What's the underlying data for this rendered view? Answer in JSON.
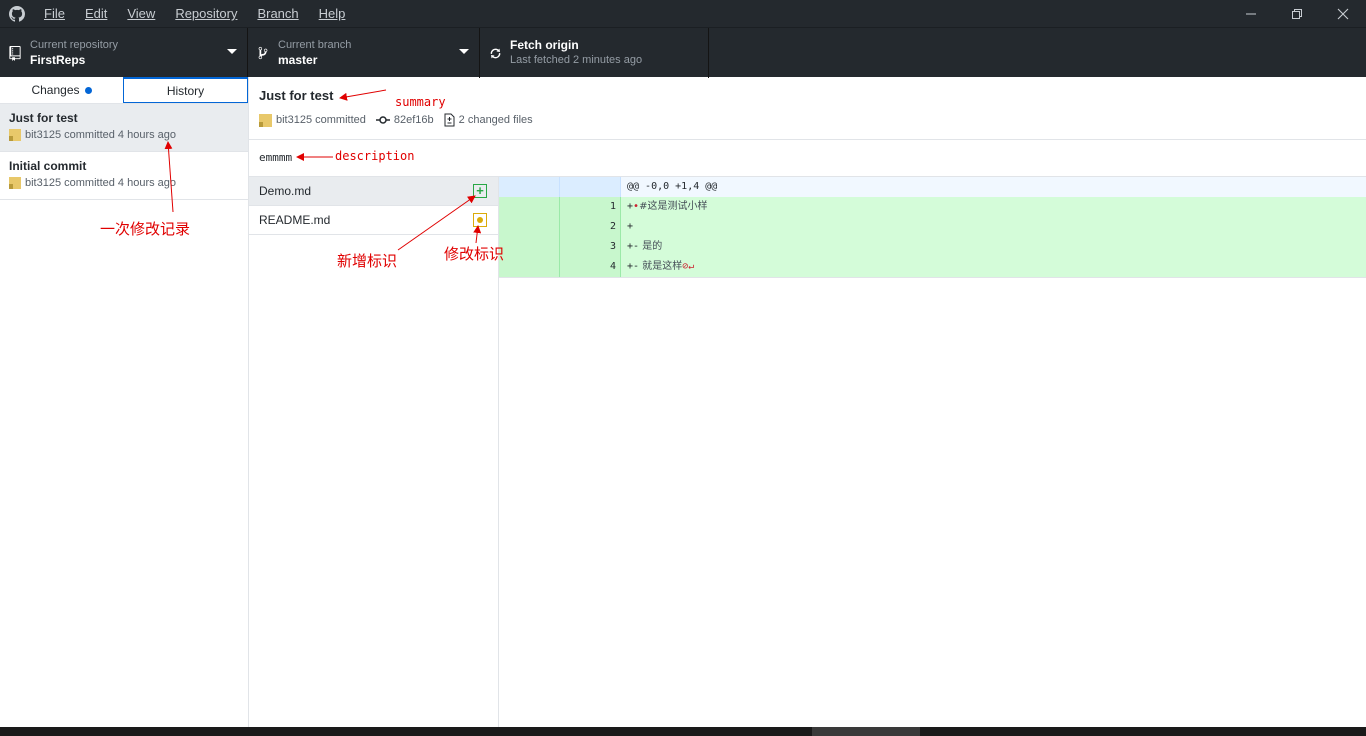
{
  "menu": [
    "File",
    "Edit",
    "View",
    "Repository",
    "Branch",
    "Help"
  ],
  "toolbar": {
    "repo_label": "Current repository",
    "repo_value": "FirstReps",
    "branch_label": "Current branch",
    "branch_value": "master",
    "fetch_title": "Fetch origin",
    "fetch_sub": "Last fetched 2 minutes ago"
  },
  "tabs": {
    "changes": "Changes",
    "history": "History"
  },
  "commits": [
    {
      "title": "Just for test",
      "meta": "bit3125 committed 4 hours ago"
    },
    {
      "title": "Initial commit",
      "meta": "bit3125 committed 4 hours ago"
    }
  ],
  "summary": {
    "title": "Just for test",
    "author": "bit3125 committed",
    "sha": "82ef16b",
    "changed": "2 changed files"
  },
  "description": "emmmm",
  "files": [
    {
      "name": "Demo.md",
      "status": "added"
    },
    {
      "name": "README.md",
      "status": "modified"
    }
  ],
  "diff": {
    "hunk": "@@ -0,0 +1,4 @@",
    "lines": [
      {
        "num": "1",
        "prefix": "+",
        "marker": "•",
        "text": "#这是测试小样"
      },
      {
        "num": "2",
        "prefix": "+",
        "marker": "",
        "text": ""
      },
      {
        "num": "3",
        "prefix": "+-",
        "marker": "",
        "text": " 是的"
      },
      {
        "num": "4",
        "prefix": "+-",
        "marker": "",
        "text": " 就是这样",
        "end": "⊘↵"
      }
    ]
  },
  "annotations": {
    "summary": "summary",
    "description": "description",
    "commit_record": "一次修改记录",
    "added_mark": "新增标识",
    "modified_mark": "修改标识"
  },
  "colors": {
    "chrome": "#24292e",
    "accent": "#0366d6",
    "added": "#28a745",
    "modified": "#dbab09",
    "annotation": "#e00000"
  }
}
